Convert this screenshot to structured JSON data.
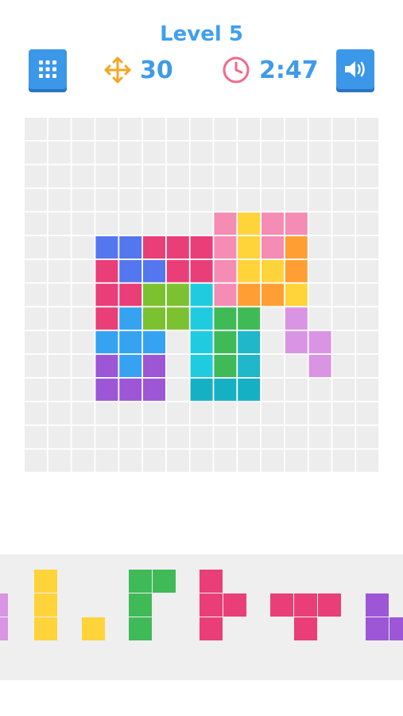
{
  "header": {
    "title": "Level 5",
    "moves": "30",
    "time": "2:47",
    "moves_icon": "move-arrows-icon",
    "time_icon": "clock-icon",
    "menu_icon": "grid-menu-icon",
    "sound_icon": "speaker-icon"
  },
  "colors": {
    "accent": "#3fa0ee",
    "button": "#3b97e8",
    "moves_icon": "#f5a623",
    "clock_icon": "#f06b8a",
    "empty_cell": "#ededed",
    "tray_bg": "#efefef"
  },
  "board": {
    "cols": 15,
    "rows": 15,
    "pieces": [
      {
        "color": "#f48cb4",
        "cells": [
          [
            8,
            4
          ],
          [
            8,
            5
          ],
          [
            8,
            6
          ],
          [
            8,
            7
          ]
        ]
      },
      {
        "color": "#ffd43a",
        "cells": [
          [
            9,
            4
          ],
          [
            9,
            5
          ],
          [
            9,
            6
          ],
          [
            10,
            6
          ]
        ]
      },
      {
        "color": "#f48cb4",
        "cells": [
          [
            10,
            4
          ],
          [
            11,
            4
          ],
          [
            10,
            5
          ]
        ]
      },
      {
        "color": "#ff9f33",
        "cells": [
          [
            11,
            5
          ],
          [
            11,
            6
          ],
          [
            9,
            7
          ],
          [
            10,
            7
          ]
        ]
      },
      {
        "color": "#ffd43a",
        "cells": [
          [
            11,
            7
          ]
        ]
      },
      {
        "color": "#5477ef",
        "cells": [
          [
            3,
            5
          ],
          [
            4,
            5
          ],
          [
            4,
            6
          ],
          [
            5,
            6
          ]
        ]
      },
      {
        "color": "#ea3e78",
        "cells": [
          [
            5,
            5
          ],
          [
            6,
            5
          ],
          [
            7,
            5
          ],
          [
            6,
            6
          ],
          [
            7,
            6
          ]
        ]
      },
      {
        "color": "#ea3e78",
        "cells": [
          [
            3,
            6
          ],
          [
            3,
            7
          ],
          [
            4,
            7
          ],
          [
            3,
            8
          ]
        ]
      },
      {
        "color": "#7cc12f",
        "cells": [
          [
            5,
            7
          ],
          [
            6,
            7
          ],
          [
            5,
            8
          ],
          [
            6,
            8
          ]
        ]
      },
      {
        "color": "#1fcbe0",
        "cells": [
          [
            7,
            7
          ],
          [
            7,
            8
          ]
        ]
      },
      {
        "color": "#35a3f2",
        "cells": [
          [
            4,
            8
          ],
          [
            3,
            9
          ],
          [
            4,
            9
          ],
          [
            5,
            9
          ],
          [
            4,
            10
          ]
        ]
      },
      {
        "color": "#3fba57",
        "cells": [
          [
            8,
            8
          ],
          [
            9,
            8
          ],
          [
            8,
            9
          ],
          [
            8,
            10
          ]
        ]
      },
      {
        "color": "#1fcbe0",
        "cells": [
          [
            7,
            9
          ],
          [
            7,
            10
          ]
        ]
      },
      {
        "color": "#1fb7c9",
        "cells": [
          [
            9,
            9
          ],
          [
            9,
            10
          ]
        ]
      },
      {
        "color": "#9c56d6",
        "cells": [
          [
            3,
            10
          ],
          [
            3,
            11
          ],
          [
            4,
            11
          ],
          [
            5,
            11
          ],
          [
            5,
            10
          ]
        ]
      },
      {
        "color": "#16b0c4",
        "cells": [
          [
            7,
            11
          ],
          [
            8,
            11
          ],
          [
            9,
            11
          ]
        ]
      },
      {
        "color": "#d994e3",
        "cells": [
          [
            11,
            8
          ],
          [
            11,
            9
          ],
          [
            12,
            9
          ],
          [
            12,
            10
          ]
        ]
      }
    ]
  },
  "tray": {
    "pieces": [
      {
        "color": "#d994e3",
        "cells": [
          [
            0,
            0
          ],
          [
            0,
            1
          ]
        ]
      },
      {
        "color": "#ffd43a",
        "cells": [
          [
            0,
            0
          ],
          [
            0,
            1
          ],
          [
            0,
            2
          ]
        ]
      },
      {
        "color": "#ffd43a",
        "cells": [
          [
            0,
            0
          ]
        ]
      },
      {
        "color": "#3fba57",
        "cells": [
          [
            0,
            0
          ],
          [
            1,
            0
          ],
          [
            0,
            1
          ],
          [
            0,
            2
          ]
        ]
      },
      {
        "color": "#ea3e78",
        "cells": [
          [
            0,
            0
          ],
          [
            0,
            1
          ],
          [
            1,
            1
          ],
          [
            0,
            2
          ]
        ]
      },
      {
        "color": "#ea3e78",
        "cells": [
          [
            0,
            0
          ],
          [
            1,
            0
          ],
          [
            2,
            0
          ],
          [
            1,
            1
          ]
        ]
      },
      {
        "color": "#9c56d6",
        "cells": [
          [
            0,
            0
          ],
          [
            0,
            1
          ],
          [
            1,
            1
          ]
        ]
      }
    ]
  }
}
